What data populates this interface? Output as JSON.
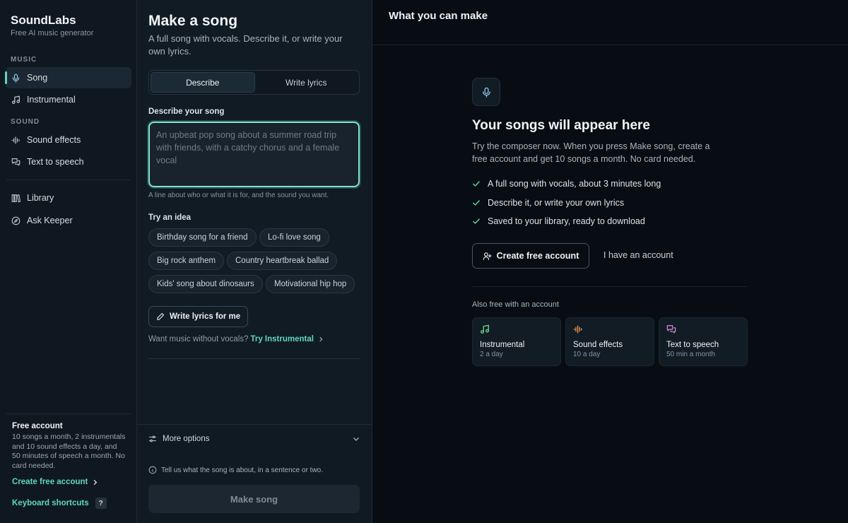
{
  "brand": {
    "title": "SoundLabs",
    "subtitle": "Free AI music generator"
  },
  "sidebar": {
    "music_label": "MUSIC",
    "sound_label": "SOUND",
    "items": [
      {
        "label": "Song",
        "icon": "mic-icon",
        "active": true
      },
      {
        "label": "Instrumental",
        "icon": "music-note-icon"
      },
      {
        "label": "Sound effects",
        "icon": "waveform-icon"
      },
      {
        "label": "Text to speech",
        "icon": "chat-bubbles-icon"
      },
      {
        "label": "Library",
        "icon": "library-icon"
      },
      {
        "label": "Ask Keeper",
        "icon": "compass-icon"
      }
    ],
    "free_account": {
      "title": "Free account",
      "description": "10 songs a month, 2 instrumentals and 10 sound effects a day, and 50 minutes of speech a month. No card needed.",
      "create_link": "Create free account"
    },
    "keyboard_shortcuts": "Keyboard shortcuts",
    "shortcut_key": "?"
  },
  "composer": {
    "title": "Make a song",
    "subtitle": "A full song with vocals. Describe it, or write your own lyrics.",
    "tabs": [
      {
        "label": "Describe",
        "active": true
      },
      {
        "label": "Write lyrics",
        "active": false
      }
    ],
    "field_label": "Describe your song",
    "textarea": {
      "value": "",
      "placeholder": "An upbeat pop song about a summer road trip with friends, with a catchy chorus and a female vocal"
    },
    "hint": "A line about who or what it is for, and the sound you want.",
    "try_label": "Try an idea",
    "ideas": [
      "Birthday song for a friend",
      "Lo-fi love song",
      "Big rock anthem",
      "Country heartbreak ballad",
      "Kids' song about dinosaurs",
      "Motivational hip hop"
    ],
    "write_lyrics_button": "Write lyrics for me",
    "no_vocals_text": "Want music without vocals?",
    "try_instrumental_link": "Try Instrumental",
    "more_options": "More options",
    "info": "Tell us what the song is about, in a sentence or two.",
    "make_button": "Make song"
  },
  "preview": {
    "title": "What you can make",
    "empty_title": "Your songs will appear here",
    "empty_desc": "Try the composer now. When you press Make song, create a free account and get 10 songs a month. No card needed.",
    "features": [
      "A full song with vocals, about 3 minutes long",
      "Describe it, or write your own lyrics",
      "Saved to your library, ready to download"
    ],
    "create_button": "Create free account",
    "have_account": "I have an account",
    "also_label": "Also free with an account",
    "cards": [
      {
        "title": "Instrumental",
        "sub": "2 a day",
        "icon": "music-note-icon",
        "color": "#6fd98a"
      },
      {
        "title": "Sound effects",
        "sub": "10 a day",
        "icon": "waveform-icon",
        "color": "#e8954a"
      },
      {
        "title": "Text to speech",
        "sub": "50 min a month",
        "icon": "chat-bubbles-icon",
        "color": "#d68ad9"
      }
    ]
  },
  "colors": {
    "accent": "#5fd6c0",
    "background": "#0b1117",
    "sidebar": "#0f1820",
    "panel": "#111b24"
  }
}
